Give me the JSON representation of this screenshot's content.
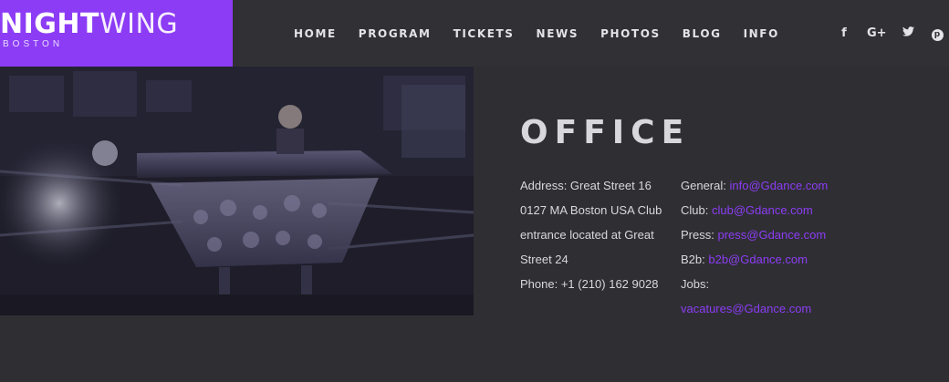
{
  "logo": {
    "bold": "NIGHT",
    "light": "WING",
    "sub": "BOSTON"
  },
  "nav": {
    "items": [
      "HOME",
      "PROGRAM",
      "TICKETS",
      "NEWS",
      "PHOTOS",
      "BLOG",
      "INFO"
    ]
  },
  "social": {
    "facebook": "f",
    "googleplus": "G+",
    "twitter": "🐦",
    "pinterest": "p"
  },
  "office": {
    "title": "OFFICE",
    "address_lines": [
      "Address: Great Street 16",
      "0127 MA Boston USA Club",
      "entrance located at Great",
      "Street 24",
      "Phone: +1 (210) 162 9028"
    ],
    "contacts": [
      {
        "label": "General: ",
        "email": "info@Gdance.com"
      },
      {
        "label": "Club: ",
        "email": "club@Gdance.com"
      },
      {
        "label": "Press: ",
        "email": "press@Gdance.com"
      },
      {
        "label": "B2b: ",
        "email": "b2b@Gdance.com"
      },
      {
        "label": "Jobs:",
        "email": ""
      },
      {
        "label": "",
        "email": "vacatures@Gdance.com"
      }
    ]
  },
  "colors": {
    "accent": "#8c3cf5",
    "background": "#2f2f33",
    "header": "#313135"
  }
}
